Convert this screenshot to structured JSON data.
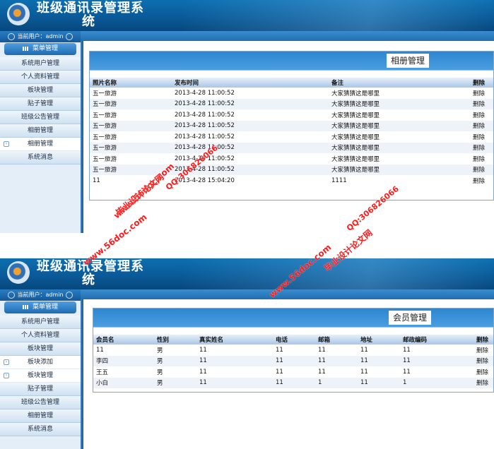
{
  "app": {
    "title_line1": "班级通讯录管理系",
    "title_line2": "统"
  },
  "user_bar": "当前用户：admin",
  "menu_label": "菜单管理",
  "screen1": {
    "menu": [
      {
        "label": "系统用户管理",
        "sub": false
      },
      {
        "label": "个人资料管理",
        "sub": false
      },
      {
        "label": "板块管理",
        "sub": false
      },
      {
        "label": "贴子管理",
        "sub": false
      },
      {
        "label": "班级公告管理",
        "sub": false
      },
      {
        "label": "相册管理",
        "sub": false
      },
      {
        "label": "相册管理",
        "sub": true
      },
      {
        "label": "系统消息",
        "sub": false
      }
    ],
    "panel_title": "相册管理",
    "columns": [
      "照片名称",
      "发布时间",
      "备注",
      "删除"
    ],
    "rows": [
      [
        "五一旅游",
        "2013-4-28 11:00:52",
        "大家猜猜这是哪里",
        "删除"
      ],
      [
        "五一旅游",
        "2013-4-28 11:00:52",
        "大家猜猜这是哪里",
        "删除"
      ],
      [
        "五一旅游",
        "2013-4-28 11:00:52",
        "大家猜猜这是哪里",
        "删除"
      ],
      [
        "五一旅游",
        "2013-4-28 11:00:52",
        "大家猜猜这是哪里",
        "删除"
      ],
      [
        "五一旅游",
        "2013-4-28 11:00:52",
        "大家猜猜这是哪里",
        "删除"
      ],
      [
        "五一旅游",
        "2013-4-28 11:00:52",
        "大家猜猜这是哪里",
        "删除"
      ],
      [
        "五一旅游",
        "2013-4-28 11:00:52",
        "大家猜猜这是哪里",
        "删除"
      ],
      [
        "五一旅游",
        "2013-4-28 11:00:52",
        "大家猜猜这是哪里",
        "删除"
      ],
      [
        "11",
        "2013-4-28 15:04:20",
        "1111",
        "删除"
      ]
    ]
  },
  "screen2": {
    "menu": [
      {
        "label": "系统用户管理",
        "sub": false
      },
      {
        "label": "个人资料管理",
        "sub": false
      },
      {
        "label": "板块管理",
        "sub": false
      },
      {
        "label": "板块添加",
        "sub": true
      },
      {
        "label": "板块管理",
        "sub": true
      },
      {
        "label": "贴子管理",
        "sub": false
      },
      {
        "label": "班级公告管理",
        "sub": false
      },
      {
        "label": "相册管理",
        "sub": false
      },
      {
        "label": "系统消息",
        "sub": false
      }
    ],
    "panel_title": "会员管理",
    "columns": [
      "会员名",
      "性别",
      "真实姓名",
      "电话",
      "邮箱",
      "地址",
      "邮政编码",
      "删除"
    ],
    "rows": [
      [
        "11",
        "男",
        "11",
        "11",
        "11",
        "11",
        "11",
        "删除"
      ],
      [
        "李四",
        "男",
        "11",
        "11",
        "11",
        "11",
        "11",
        "删除"
      ],
      [
        "王五",
        "男",
        "11",
        "11",
        "11",
        "11",
        "11",
        "删除"
      ],
      [
        "小白",
        "男",
        "11",
        "11",
        "1",
        "11",
        "1",
        "删除"
      ]
    ]
  },
  "watermarks": {
    "site": "www.56doc.com",
    "qq": "QQ:306826066",
    "name": "毕业设计论文网"
  },
  "colors": {
    "banner": "#0a5a98",
    "header_row": "#a9c6e5",
    "watermark": "#ff1a1a"
  }
}
